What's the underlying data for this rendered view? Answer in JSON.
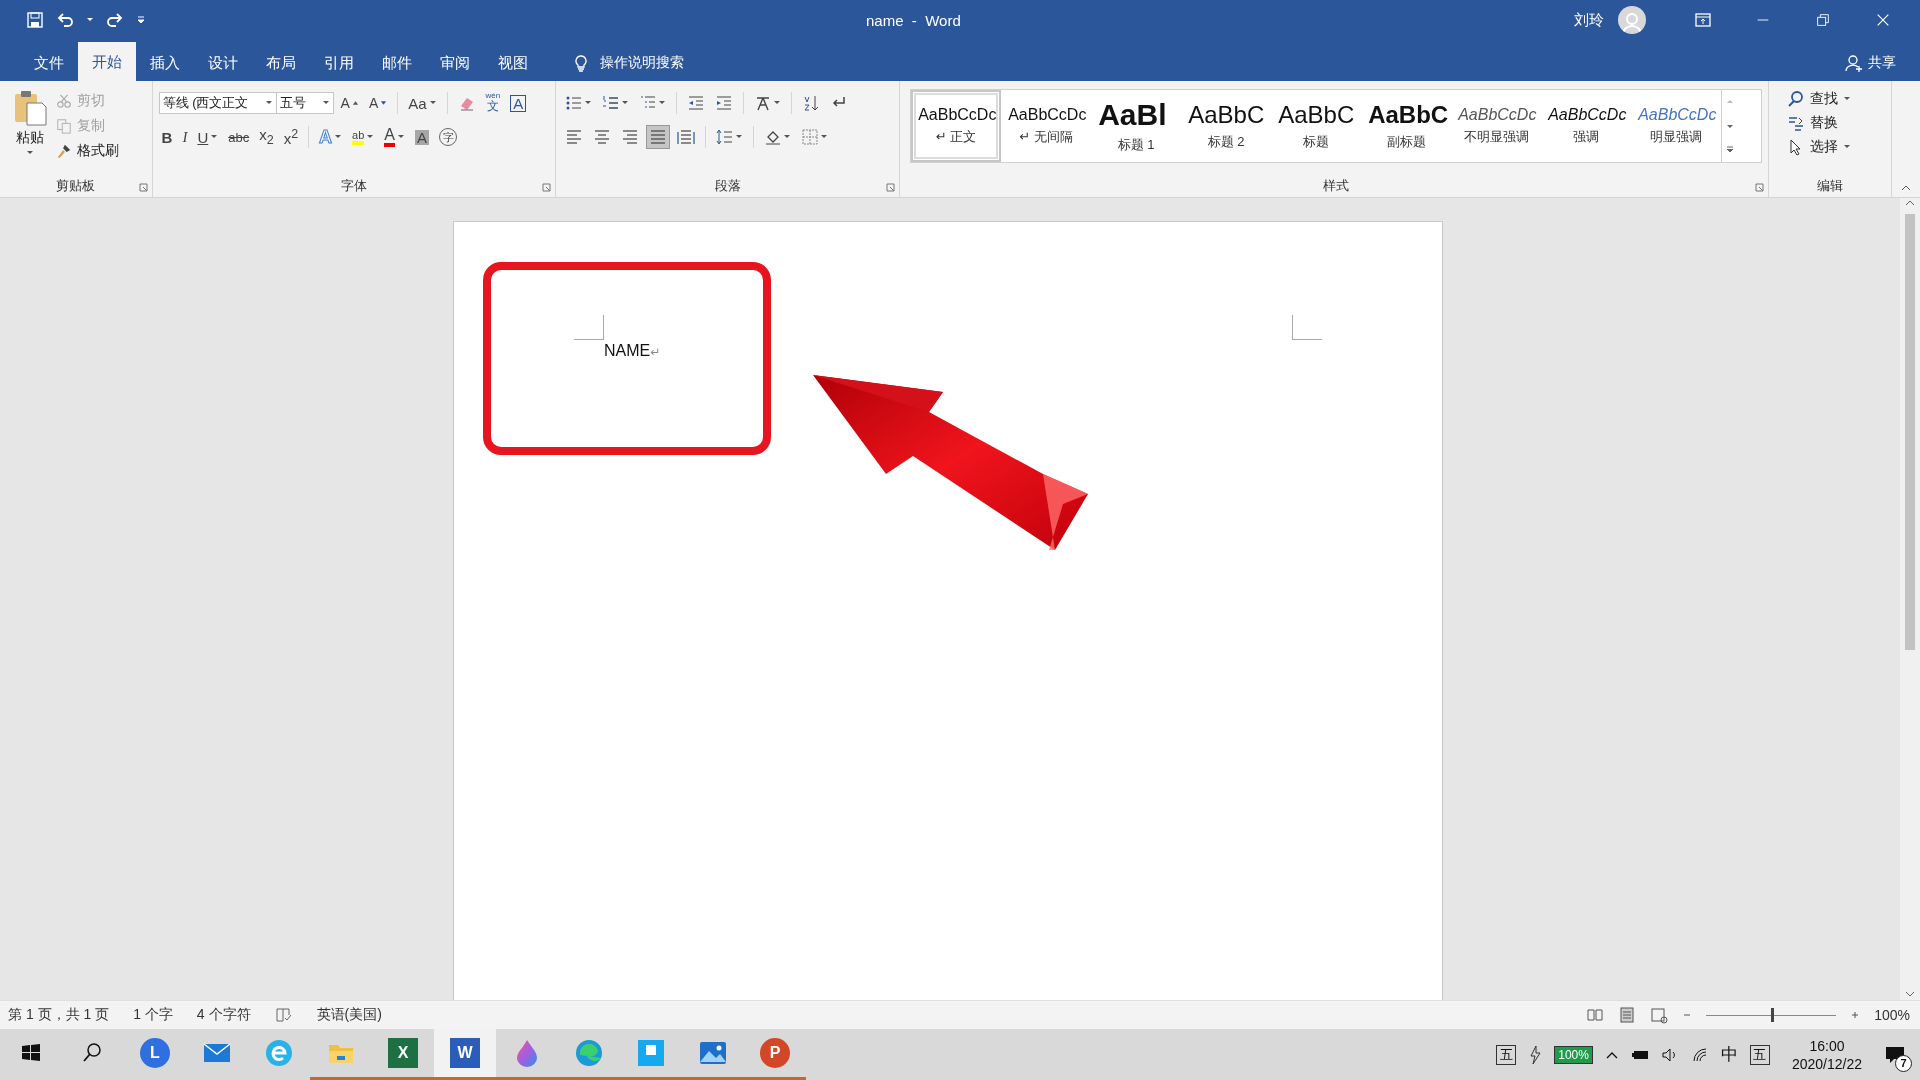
{
  "window": {
    "title": "name  -  Word",
    "user": "刘玲"
  },
  "tabs": [
    {
      "label": "文件",
      "selected": false
    },
    {
      "label": "开始",
      "selected": true
    },
    {
      "label": "插入",
      "selected": false
    },
    {
      "label": "设计",
      "selected": false
    },
    {
      "label": "布局",
      "selected": false
    },
    {
      "label": "引用",
      "selected": false
    },
    {
      "label": "邮件",
      "selected": false
    },
    {
      "label": "审阅",
      "selected": false
    },
    {
      "label": "视图",
      "selected": false
    }
  ],
  "tell_me": "操作说明搜索",
  "share": "共享",
  "clipboard": {
    "paste": "粘贴",
    "group": "剪贴板",
    "items": [
      {
        "kind": "cut",
        "label": "剪切",
        "disabled": true
      },
      {
        "kind": "copy",
        "label": "复制",
        "disabled": true
      },
      {
        "kind": "painter",
        "label": "格式刷",
        "disabled": false
      }
    ]
  },
  "font": {
    "group": "字体",
    "name": "等线 (西文正文",
    "size": "五号",
    "row1": [
      {
        "kind": "grow",
        "label": "A",
        "dropdown": false
      },
      {
        "kind": "shrink",
        "label": "A",
        "dropdown": false
      },
      {
        "kind": "case",
        "label": "Aa",
        "dropdown": true
      },
      {
        "kind": "clear",
        "dropdown": false
      },
      {
        "kind": "phonetic",
        "ruby": "wén",
        "label": "文",
        "dropdown": false
      },
      {
        "kind": "border",
        "label": "A",
        "dropdown": false
      }
    ],
    "row2": [
      {
        "kind": "bold",
        "label": "B",
        "dropdown": false
      },
      {
        "kind": "italic",
        "label": "I",
        "dropdown": false
      },
      {
        "kind": "underline",
        "label": "U",
        "dropdown": true
      },
      {
        "kind": "strike",
        "label": "abc",
        "dropdown": false
      },
      {
        "kind": "plain",
        "label": "x$_{2}$",
        "dropdown": false
      },
      {
        "kind": "plain",
        "label": "x$^{2}$",
        "dropdown": false
      },
      {
        "kind": "effect",
        "label": "A",
        "dropdown": true
      },
      {
        "kind": "highlight",
        "label": "ab",
        "dropdown": true
      },
      {
        "kind": "color",
        "label": "A",
        "dropdown": true
      },
      {
        "kind": "shade",
        "label": "A",
        "dropdown": false
      },
      {
        "kind": "enclose",
        "label": "字",
        "dropdown": false
      }
    ]
  },
  "paragraph": {
    "group": "段落",
    "alignment": [
      {
        "kind": "left",
        "selected": false
      },
      {
        "kind": "center",
        "selected": false
      },
      {
        "kind": "right",
        "selected": false
      },
      {
        "kind": "justify",
        "selected": true
      },
      {
        "kind": "distributed",
        "selected": false
      }
    ]
  },
  "styles": {
    "group": "样式",
    "items": [
      {
        "preview": "AaBbCcDc",
        "label": "↵ 正文",
        "kind": "normal",
        "selected": true
      },
      {
        "preview": "AaBbCcDc",
        "label": "↵ 无间隔",
        "kind": "normal",
        "selected": false
      },
      {
        "preview": "AaBl",
        "label": "标题 1",
        "kind": "h1",
        "selected": false
      },
      {
        "preview": "AaBbC",
        "label": "标题 2",
        "kind": "h2",
        "selected": false
      },
      {
        "preview": "AaBbC",
        "label": "标题",
        "kind": "title",
        "selected": false
      },
      {
        "preview": "AaBbC",
        "label": "副标题",
        "kind": "subtitle",
        "selected": false
      },
      {
        "preview": "AaBbCcDc",
        "label": "不明显强调",
        "kind": "subtle",
        "selected": false
      },
      {
        "preview": "AaBbCcDc",
        "label": "强调",
        "kind": "emphasis",
        "selected": false
      },
      {
        "preview": "AaBbCcDc",
        "label": "明显强调",
        "kind": "intense",
        "selected": false
      }
    ]
  },
  "editing": {
    "group": "编辑",
    "items": [
      {
        "kind": "find",
        "label": "查找",
        "dropdown": true
      },
      {
        "kind": "replace",
        "label": "替换",
        "dropdown": false
      },
      {
        "kind": "select",
        "label": "选择",
        "dropdown": true
      }
    ]
  },
  "document": {
    "text": "NAME",
    "mark": "↵"
  },
  "status_bar": {
    "items": [
      "第 1 页，共 1 页",
      "1 个字",
      "4 个字符"
    ],
    "language": "英语(美国)",
    "zoom": "100%",
    "zoom_slider": {
      "level": 0.5
    }
  },
  "taskbar": {
    "apps": [
      {
        "kind": "circle-app",
        "glyph": "L",
        "running": false,
        "selected": false
      },
      {
        "kind": "mail",
        "running": false,
        "selected": false
      },
      {
        "kind": "e-browser",
        "running": false,
        "selected": false
      },
      {
        "kind": "folder",
        "running": true,
        "selected": false
      },
      {
        "kind": "excel",
        "glyph": "X",
        "running": true,
        "selected": false
      },
      {
        "kind": "word",
        "glyph": "W",
        "running": true,
        "selected": true
      },
      {
        "kind": "paint",
        "running": true,
        "selected": false
      },
      {
        "kind": "edge",
        "running": true,
        "selected": false
      },
      {
        "kind": "tile-app",
        "running": true,
        "selected": false
      },
      {
        "kind": "photos",
        "running": true,
        "selected": false
      },
      {
        "kind": "powerpoint",
        "glyph": "P",
        "running": true,
        "selected": false
      }
    ],
    "ime_left": "五",
    "battery": "100%",
    "language": "中",
    "ime_right": "五",
    "time": "16:00",
    "date": "2020/12/22",
    "notifications": "7"
  }
}
